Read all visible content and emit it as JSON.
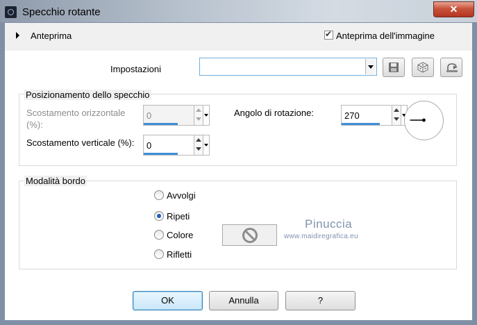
{
  "window": {
    "title": "Specchio rotante",
    "close_label": "✕",
    "app_icon": "app-camera-icon"
  },
  "preview_bar": {
    "expand_icon": "triangle-right-icon",
    "label": "Anteprima",
    "image_preview": {
      "label": "Anteprima dell'immagine",
      "checked": true
    }
  },
  "settings": {
    "label": "Impostazioni",
    "preset_value": "",
    "icons": [
      "save-preset-icon",
      "randomize-icon",
      "reset-icon"
    ]
  },
  "mirror_position": {
    "title": "Posizionamento dello specchio",
    "horizontal_offset": {
      "label": "Scostamento orizzontale (%):",
      "value": "0",
      "enabled": false
    },
    "vertical_offset": {
      "label": "Scostamento verticale (%):",
      "value": "0",
      "enabled": true
    },
    "rotation_angle": {
      "label": "Angolo di rotazione:",
      "value": "270",
      "dial_degrees": 270
    }
  },
  "edge_mode": {
    "title": "Modalità bordo",
    "options": [
      {
        "label": "Avvolgi",
        "checked": false
      },
      {
        "label": "Ripeti",
        "checked": true
      },
      {
        "label": "Colore",
        "checked": false
      },
      {
        "label": "Rifletti",
        "checked": false
      }
    ],
    "color_swatch_icon": "no-color-icon"
  },
  "watermark": {
    "name": "Pinuccia",
    "url": "www.maidiregrafica.eu"
  },
  "buttons": {
    "ok": "OK",
    "cancel": "Annulla",
    "help": "?"
  },
  "colors": {
    "accent": "#3f8fd8",
    "focus_border": "#6faee0",
    "close_red": "#c8533c"
  }
}
